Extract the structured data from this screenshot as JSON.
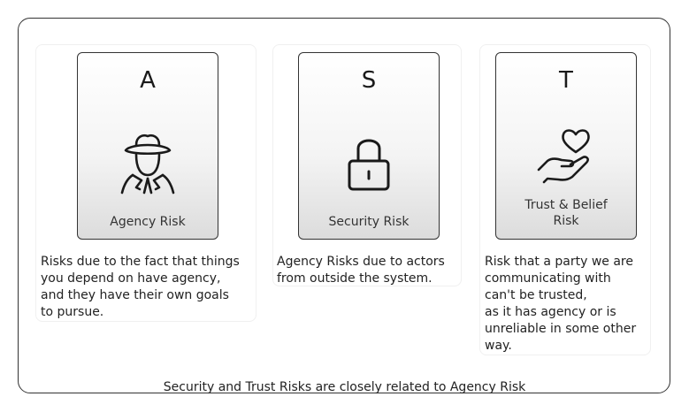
{
  "cards": [
    {
      "letter": "A",
      "label": "Agency Risk",
      "icon": "spy-agent-icon",
      "description": "Risks due to the fact that things\nyou depend on have agency,\nand they have their own goals\nto pursue."
    },
    {
      "letter": "S",
      "label": "Security Risk",
      "icon": "padlock-icon",
      "description": "Agency Risks due to actors\nfrom outside the system."
    },
    {
      "letter": "T",
      "label": "Trust & Belief\nRisk",
      "icon": "heart-in-hand-icon",
      "description": "Risk that a party we are\ncommunicating with\ncan't be trusted,\nas it has agency or is\nunreliable in some other\nway."
    }
  ],
  "caption": "Security and Trust Risks are closely related to Agency Risk"
}
